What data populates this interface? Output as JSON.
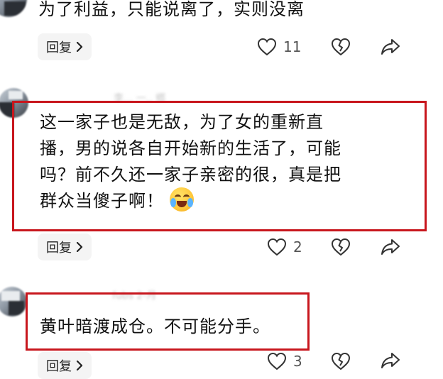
{
  "comments": [
    {
      "text": "为了利益，只能说离了，实则没离",
      "reply_label": "回复",
      "likes": "11"
    },
    {
      "author": "李... 一.. 鄕",
      "lines": [
        "这一家子也是无敌，为了女的重新直",
        "播，男的说各自开始新的生活了，可能",
        "吗？前不久还一家子亲密的很，真是把",
        "群众当傻子啊！"
      ],
      "reply_label": "回复",
      "likes": "2",
      "highlight_color": "#c8161d"
    },
    {
      "author": "fubs 2-月",
      "text": "黄叶暗渡成仓。不可能分手。",
      "reply_label": "回复",
      "likes": "3",
      "highlight_color": "#c8161d"
    }
  ],
  "icons": {
    "reply_chevron": "chevron-right-icon",
    "like": "heart-icon",
    "dislike": "broken-heart-icon",
    "share": "share-arrow-icon",
    "emoji": "laughing-crying-emoji-icon"
  }
}
